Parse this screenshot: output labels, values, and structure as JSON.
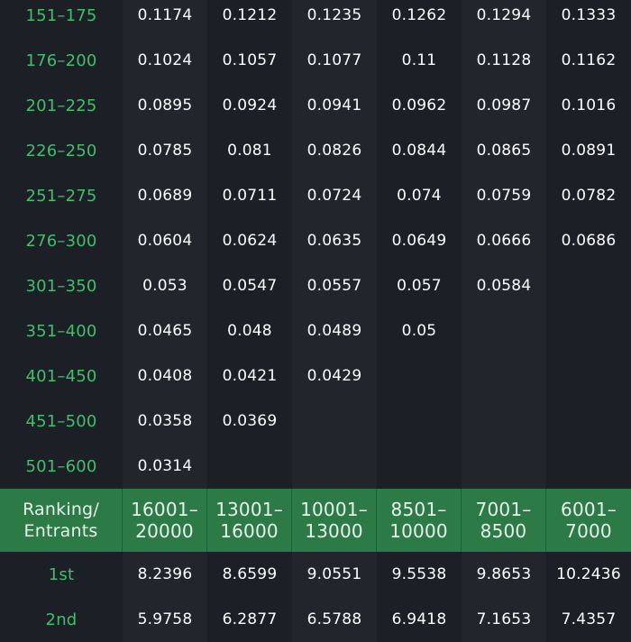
{
  "top_rows": [
    {
      "range": "151–175",
      "values": [
        "0.1174",
        "0.1212",
        "0.1235",
        "0.1262",
        "0.1294",
        "0.1333"
      ]
    },
    {
      "range": "176–200",
      "values": [
        "0.1024",
        "0.1057",
        "0.1077",
        "0.11",
        "0.1128",
        "0.1162"
      ]
    },
    {
      "range": "201–225",
      "values": [
        "0.0895",
        "0.0924",
        "0.0941",
        "0.0962",
        "0.0987",
        "0.1016"
      ]
    },
    {
      "range": "226–250",
      "values": [
        "0.0785",
        "0.081",
        "0.0826",
        "0.0844",
        "0.0865",
        "0.0891"
      ]
    },
    {
      "range": "251–275",
      "values": [
        "0.0689",
        "0.0711",
        "0.0724",
        "0.074",
        "0.0759",
        "0.0782"
      ]
    },
    {
      "range": "276–300",
      "values": [
        "0.0604",
        "0.0624",
        "0.0635",
        "0.0649",
        "0.0666",
        "0.0686"
      ]
    },
    {
      "range": "301–350",
      "values": [
        "0.053",
        "0.0547",
        "0.0557",
        "0.057",
        "0.0584",
        ""
      ]
    },
    {
      "range": "351–400",
      "values": [
        "0.0465",
        "0.048",
        "0.0489",
        "0.05",
        "",
        ""
      ]
    },
    {
      "range": "401–450",
      "values": [
        "0.0408",
        "0.0421",
        "0.0429",
        "",
        "",
        ""
      ]
    },
    {
      "range": "451–500",
      "values": [
        "0.0358",
        "0.0369",
        "",
        "",
        "",
        ""
      ]
    },
    {
      "range": "501–600",
      "values": [
        "0.0314",
        "",
        "",
        "",
        "",
        ""
      ]
    }
  ],
  "header": {
    "first_line1": "Ranking/",
    "first_line2": "Entrants",
    "columns": [
      {
        "line1": "16001–",
        "line2": "20000"
      },
      {
        "line1": "13001–",
        "line2": "16000"
      },
      {
        "line1": "10001–",
        "line2": "13000"
      },
      {
        "line1": "8501–",
        "line2": "10000"
      },
      {
        "line1": "7001–",
        "line2": "8500"
      },
      {
        "line1": "6001–",
        "line2": "7000"
      }
    ]
  },
  "bottom_rows": [
    {
      "range": "1st",
      "values": [
        "8.2396",
        "8.6599",
        "9.0551",
        "9.5538",
        "9.8653",
        "10.2436"
      ]
    },
    {
      "range": "2nd",
      "values": [
        "5.9758",
        "6.2877",
        "6.5788",
        "6.9418",
        "7.1653",
        "7.4357"
      ]
    }
  ]
}
